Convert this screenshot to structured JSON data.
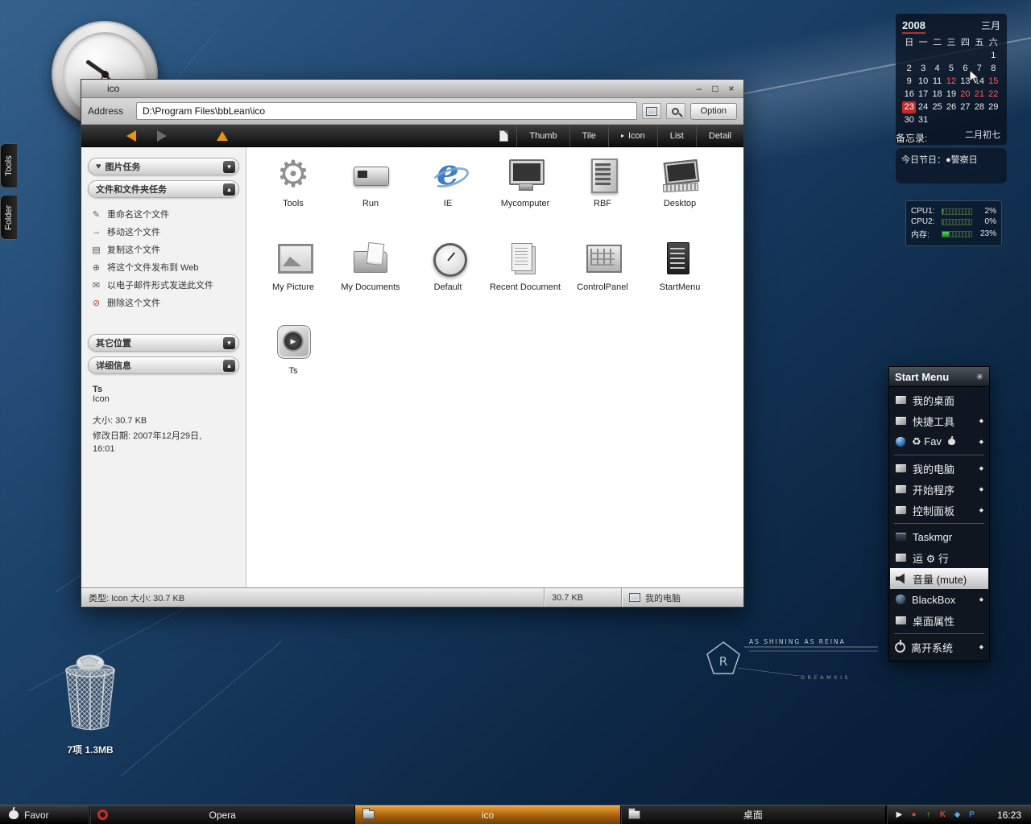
{
  "ui": {
    "chevron_down": "▾",
    "chevron_up": "▴",
    "heart_glyph": "♥"
  },
  "side_tabs": [
    {
      "label": "Tools"
    },
    {
      "label": "Folder"
    }
  ],
  "explorer": {
    "title": "ico",
    "window_buttons": [
      "–",
      "□",
      "×"
    ],
    "address": {
      "label": "Address",
      "value": "D:\\Program Files\\bbLean\\ico",
      "option_label": "Option"
    },
    "toolbar": {
      "views": [
        "Thumb",
        "Tile",
        "Icon",
        "List",
        "Detail"
      ],
      "active_view": "Icon",
      "active_marker": "▸"
    },
    "sidebar": {
      "panels": [
        {
          "title": "图片任务",
          "state": "collapsed",
          "icon_glyph": "♥"
        },
        {
          "title": "文件和文件夹任务",
          "state": "expanded",
          "items": [
            {
              "label": "重命名这个文件",
              "icon": "rename",
              "glyph": "✎"
            },
            {
              "label": "移动这个文件",
              "icon": "move",
              "glyph": "→"
            },
            {
              "label": "复制这个文件",
              "icon": "copy",
              "glyph": "▤"
            },
            {
              "label": "将这个文件发布到 Web",
              "icon": "web",
              "glyph": "⊕"
            },
            {
              "label": "以电子邮件形式发送此文件",
              "icon": "mail",
              "glyph": "✉"
            },
            {
              "label": "删除这个文件",
              "icon": "delete",
              "glyph": "⊘"
            }
          ]
        },
        {
          "title": "其它位置",
          "state": "collapsed"
        },
        {
          "title": "详细信息",
          "state": "expanded",
          "details": {
            "name": "Ts",
            "type": "Icon",
            "lines": [
              "大小: 30.7 KB",
              "修改日期: 2007年12月29日,",
              "16:01"
            ]
          }
        }
      ]
    },
    "icons": [
      {
        "label": "Tools",
        "icon": "gear"
      },
      {
        "label": "Run",
        "icon": "run"
      },
      {
        "label": "IE",
        "icon": "ie"
      },
      {
        "label": "Mycomputer",
        "icon": "monitor"
      },
      {
        "label": "RBF",
        "icon": "tower"
      },
      {
        "label": "Desktop",
        "icon": "desktop"
      },
      {
        "label": "My Picture",
        "icon": "picture"
      },
      {
        "label": "My Documents",
        "icon": "documents"
      },
      {
        "label": "Default",
        "icon": "gauge"
      },
      {
        "label": "Recent Document",
        "icon": "recent"
      },
      {
        "label": "ControlPanel",
        "icon": "panel"
      },
      {
        "label": "StartMenu",
        "icon": "startmenu"
      },
      {
        "label": "Ts",
        "icon": "ts"
      }
    ],
    "statusbar": {
      "left": "类型: Icon 大小: 30.7 KB",
      "size": "30.7 KB",
      "location": "我的电脑"
    }
  },
  "calendar": {
    "year": "2008",
    "month": "三月",
    "weekdays": [
      "日",
      "一",
      "二",
      "三",
      "四",
      "五",
      "六"
    ],
    "weeks": [
      [
        "",
        "",
        "",
        "",
        "",
        "",
        "1"
      ],
      [
        "2",
        "3",
        "4",
        "5",
        "6",
        "7",
        "8"
      ],
      [
        "9",
        "10",
        "11",
        "12",
        "13",
        "14",
        "15"
      ],
      [
        "16",
        "17",
        "18",
        "19",
        "20",
        "21",
        "22"
      ],
      [
        "23",
        "24",
        "25",
        "26",
        "27",
        "28",
        "29"
      ],
      [
        "30",
        "31",
        "",
        "",
        "",
        "",
        ""
      ]
    ],
    "red_dates": [
      "12",
      "15",
      "20",
      "21",
      "22"
    ],
    "today": "23",
    "lunar_label": "二月初七"
  },
  "memo": {
    "title": "备忘录:",
    "content": "今日节日：●警察日"
  },
  "system_monitor": {
    "rows": [
      {
        "label": "CPU1:",
        "value": "2%",
        "fill": 2
      },
      {
        "label": "CPU2:",
        "value": "0%",
        "fill": 0
      },
      {
        "label": "内存:",
        "value": "23%",
        "fill": 23
      }
    ]
  },
  "start_menu": {
    "title": "Start Menu",
    "header_icon": "✳",
    "arrow_glyph": "◆",
    "items": [
      {
        "label": "我的桌面",
        "icon": "desktop",
        "arrow": false
      },
      {
        "label": "快捷工具",
        "icon": "tools",
        "arrow": true
      },
      {
        "label": "♻ Fav",
        "icon": "fav",
        "arrow": true,
        "suffix_icon": "apple"
      },
      {
        "type": "separator"
      },
      {
        "label": "我的电脑",
        "icon": "computer",
        "arrow": true
      },
      {
        "label": "开始程序",
        "icon": "programs",
        "arrow": true
      },
      {
        "label": "控制面板",
        "icon": "control",
        "arrow": true
      },
      {
        "type": "separator"
      },
      {
        "label": "Taskmgr",
        "icon": "taskmgr",
        "arrow": false
      },
      {
        "label": "运 ⚙ 行",
        "icon": "run",
        "arrow": false
      },
      {
        "label": "音量 (mute)",
        "icon": "volume",
        "arrow": false,
        "highlighted": true
      },
      {
        "label": "BlackBox",
        "icon": "blackbox",
        "arrow": true
      },
      {
        "label": "桌面属性",
        "icon": "properties",
        "arrow": false
      },
      {
        "type": "separator"
      },
      {
        "label": "离开系统",
        "icon": "power",
        "arrow": true
      }
    ]
  },
  "recycle_bin": {
    "label": "7项 1.3MB"
  },
  "watermark": {
    "line1": "AS SHINING AS REINA",
    "line2": "DREAMXIS",
    "letter": "R"
  },
  "taskbar": {
    "start_label": "Favor",
    "tasks": [
      {
        "label": "Opera",
        "active": false,
        "icon": "opera"
      },
      {
        "label": "ico",
        "active": true,
        "icon": "folder"
      },
      {
        "label": "桌面",
        "active": false,
        "icon": "folder"
      }
    ],
    "tray": [
      {
        "name": "pointer",
        "glyph": "▶",
        "color": "#f0f0f0"
      },
      {
        "name": "antivirus",
        "glyph": "●",
        "color": "#d84040"
      },
      {
        "name": "upload",
        "glyph": "↑",
        "color": "#4ad04a"
      },
      {
        "name": "k-app",
        "glyph": "K",
        "color": "#e04040"
      },
      {
        "name": "messenger",
        "glyph": "◆",
        "color": "#58a8e8"
      },
      {
        "name": "p-app",
        "glyph": "P",
        "color": "#3a86e0"
      }
    ],
    "clock": "16:23"
  }
}
